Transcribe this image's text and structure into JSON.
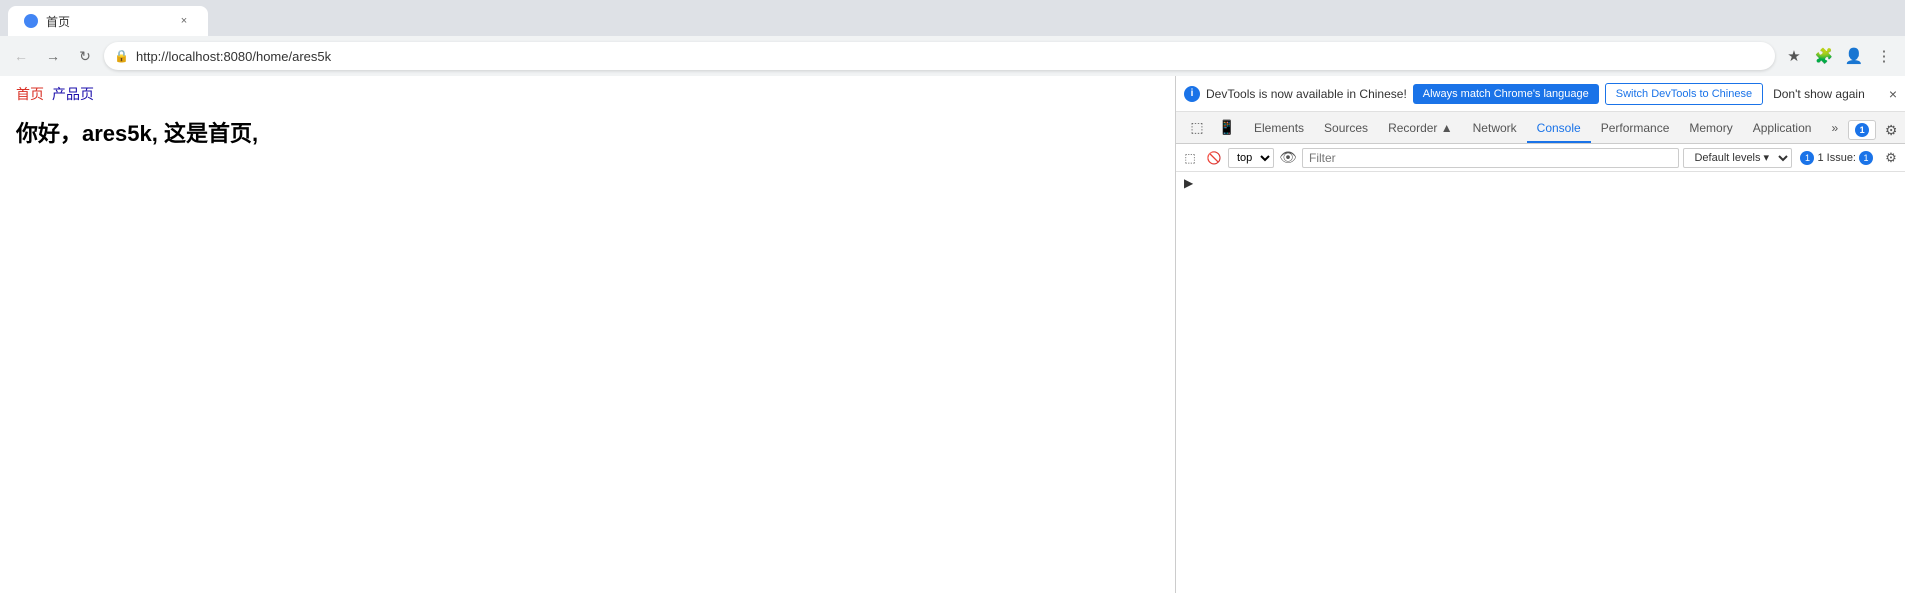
{
  "browser": {
    "url": "http://localhost:8080/home/ares5k",
    "tab_title": "首页"
  },
  "page": {
    "nav_links": [
      {
        "text": "首页",
        "active": true
      },
      {
        "text": "产品页",
        "active": false
      }
    ],
    "heading": "你好，ares5k, 这是首页,"
  },
  "devtools": {
    "notification": {
      "message": "DevTools is now available in Chinese!",
      "btn_always_match": "Always match Chrome's language",
      "btn_switch": "Switch DevTools to Chinese",
      "btn_dont_show": "Don't show again"
    },
    "tabs": [
      {
        "label": "Elements",
        "active": false
      },
      {
        "label": "Sources",
        "active": false
      },
      {
        "label": "Recorder ▲",
        "active": false
      },
      {
        "label": "Network",
        "active": false
      },
      {
        "label": "Console",
        "active": true
      },
      {
        "label": "Performance",
        "active": false
      },
      {
        "label": "Memory",
        "active": false
      },
      {
        "label": "Application",
        "active": false
      }
    ],
    "issues_badge": "1",
    "console": {
      "filter_placeholder": "Filter",
      "top_select": "top",
      "default_levels": "Default levels ▾",
      "issues_label": "1 Issue:",
      "issues_count": "1"
    }
  },
  "icons": {
    "back": "←",
    "forward": "→",
    "reload": "↻",
    "lock": "🔒",
    "extensions": "🧩",
    "profile": "👤",
    "star": "★",
    "more": "⋮",
    "tab_close": "×",
    "devtools_close": "×",
    "devtools_more": "⋮",
    "devtools_settings": "⚙",
    "devtools_dock": "⬜",
    "devtools_undock": "⊟",
    "inspect": "⬚",
    "device": "📱",
    "clear": "🚫",
    "eye": "👁",
    "expand": "▶",
    "info": "ℹ"
  }
}
